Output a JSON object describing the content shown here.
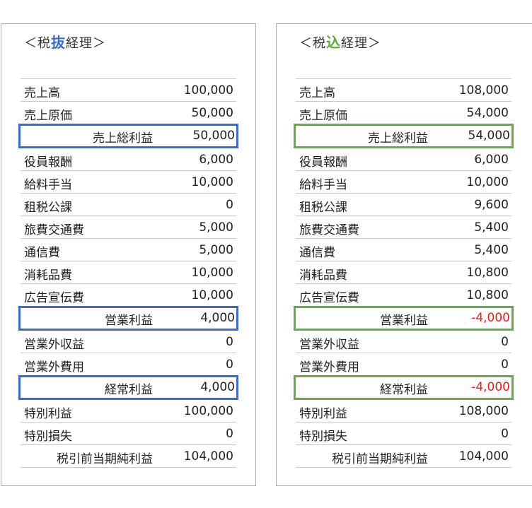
{
  "left": {
    "title_pre": "＜税",
    "title_em": "抜",
    "title_post": "経理＞",
    "rows": [
      {
        "label": "売上高",
        "value": "100,000"
      },
      {
        "label": "売上原価",
        "value": "50,000"
      },
      {
        "label": "売上総利益",
        "value": "50,000"
      },
      {
        "label": "役員報酬",
        "value": "6,000"
      },
      {
        "label": "給料手当",
        "value": "10,000"
      },
      {
        "label": "租税公課",
        "value": "0"
      },
      {
        "label": "旅費交通費",
        "value": "5,000"
      },
      {
        "label": "通信費",
        "value": "5,000"
      },
      {
        "label": "消耗品費",
        "value": "10,000"
      },
      {
        "label": "広告宣伝費",
        "value": "10,000"
      },
      {
        "label": "営業利益",
        "value": "4,000"
      },
      {
        "label": "営業外収益",
        "value": "0"
      },
      {
        "label": "営業外費用",
        "value": "0"
      },
      {
        "label": "経常利益",
        "value": "4,000"
      },
      {
        "label": "特別利益",
        "value": "100,000"
      },
      {
        "label": "特別損失",
        "value": "0"
      },
      {
        "label": "税引前当期純利益",
        "value": "104,000"
      }
    ]
  },
  "right": {
    "title_pre": "＜税",
    "title_em": "込",
    "title_post": "経理＞",
    "rows": [
      {
        "label": "売上高",
        "value": "108,000"
      },
      {
        "label": "売上原価",
        "value": "54,000"
      },
      {
        "label": "売上総利益",
        "value": "54,000"
      },
      {
        "label": "役員報酬",
        "value": "6,000"
      },
      {
        "label": "給料手当",
        "value": "10,000"
      },
      {
        "label": "租税公課",
        "value": "9,600"
      },
      {
        "label": "旅費交通費",
        "value": "5,400"
      },
      {
        "label": "通信費",
        "value": "5,400"
      },
      {
        "label": "消耗品費",
        "value": "10,800"
      },
      {
        "label": "広告宣伝費",
        "value": "10,800"
      },
      {
        "label": "営業利益",
        "value": "-4,000"
      },
      {
        "label": "営業外収益",
        "value": "0"
      },
      {
        "label": "営業外費用",
        "value": "0"
      },
      {
        "label": "経常利益",
        "value": "-4,000"
      },
      {
        "label": "特別利益",
        "value": "108,000"
      },
      {
        "label": "特別損失",
        "value": "0"
      },
      {
        "label": "税引前当期純利益",
        "value": "104,000"
      }
    ]
  },
  "colors": {
    "left_highlight": "#3a6cc8",
    "right_highlight": "#6aa84f",
    "negative": "#e02020"
  }
}
